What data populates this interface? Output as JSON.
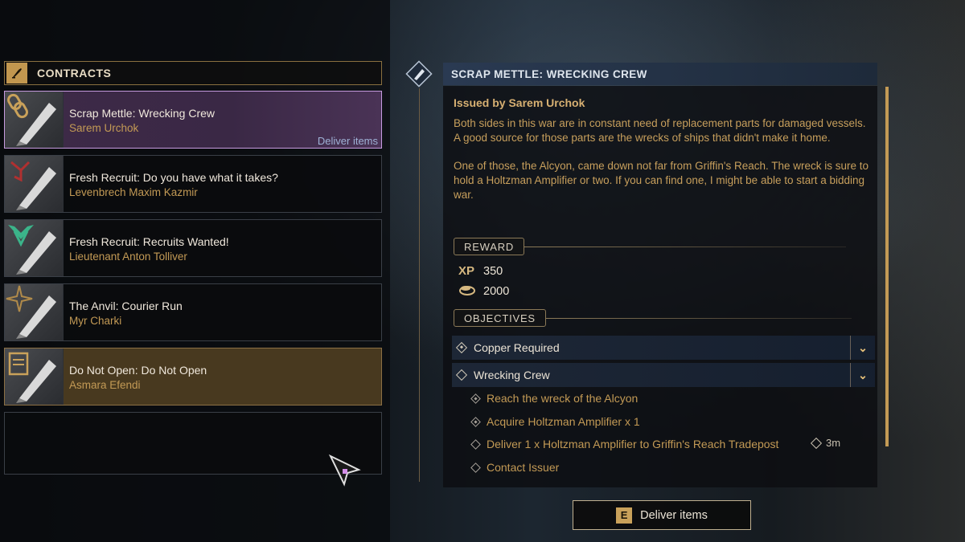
{
  "contracts": {
    "header": "CONTRACTS",
    "items": [
      {
        "title": "Scrap Mettle: Wrecking Crew",
        "issuer": "Sarem Urchok",
        "tag": "Deliver items",
        "icon": "chain-link-icon"
      },
      {
        "title": "Fresh Recruit: Do you have what it takes?",
        "issuer": "Levenbrech Maxim Kazmir",
        "icon": "red-hook-icon"
      },
      {
        "title": "Fresh Recruit: Recruits Wanted!",
        "issuer": "Lieutenant Anton Tolliver",
        "icon": "green-wings-icon"
      },
      {
        "title": "The Anvil: Courier Run",
        "issuer": "Myr Charki",
        "icon": "compass-star-icon"
      },
      {
        "title": "Do Not Open: Do Not Open",
        "issuer": "Asmara Efendi",
        "icon": "document-icon"
      }
    ]
  },
  "detail": {
    "title": "SCRAP METTLE: WRECKING CREW",
    "issued_by": "Issued by Sarem Urchok",
    "description_1": "Both sides in this war are in constant need of replacement parts for damaged vessels. A good source for those parts are the wrecks of ships that didn't make it home.",
    "description_2": "One of those, the Alcyon, came down not far from Griffin's Reach. The wreck is sure to hold a Holtzman Amplifier or two. If you can find one, I might be able to start a bidding war.",
    "reward_label": "REWARD",
    "rewards": [
      {
        "icon": "XP",
        "value": "350"
      },
      {
        "icon": "currency-icon",
        "value": "2000"
      }
    ],
    "objectives_label": "OBJECTIVES",
    "objectives": [
      {
        "label": "Copper Required",
        "completed": true
      },
      {
        "label": "Wrecking Crew",
        "completed": false
      }
    ],
    "sub_objectives": [
      {
        "label": "Reach the wreck of the Alcyon",
        "completed": true
      },
      {
        "label": "Acquire Holtzman Amplifier x 1",
        "completed": true
      },
      {
        "label": "Deliver 1 x Holtzman Amplifier to Griffin's Reach Tradepost",
        "completed": false
      },
      {
        "label": "Contact Issuer",
        "completed": false
      }
    ],
    "timer": "3m"
  },
  "action": {
    "key": "E",
    "label": "Deliver items"
  },
  "colors": {
    "gold": "#c39a55",
    "selected_purple": "#3e2a48",
    "header_blue": "#2a3a52"
  }
}
